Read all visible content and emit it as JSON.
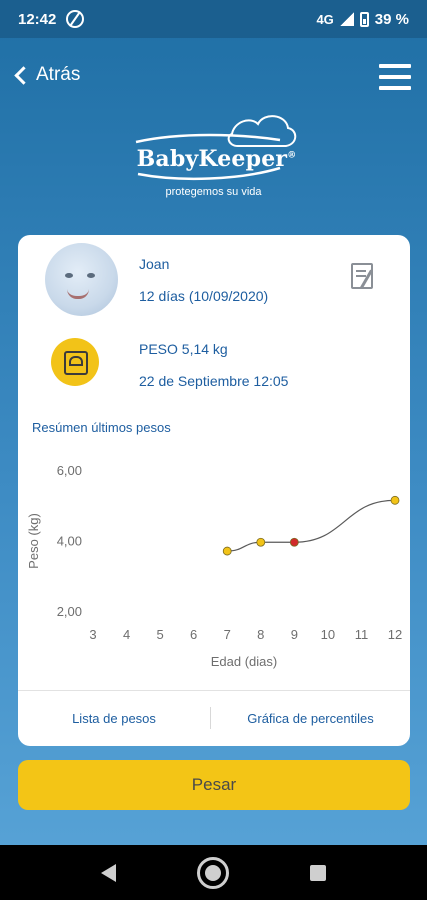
{
  "status_bar": {
    "time": "12:42",
    "network": "4G",
    "battery": "39 %"
  },
  "header": {
    "back_label": "Atrás"
  },
  "logo": {
    "brand": "BabyKeeper",
    "registered": "®",
    "tagline": "protegemos su vida"
  },
  "profile": {
    "name": "Joan",
    "age": "12 días (10/09/2020)"
  },
  "last_weight": {
    "peso": "PESO 5,14 kg",
    "fecha": "22 de Septiembre 12:05"
  },
  "chart_section_title": "Resúmen últimos pesos",
  "chart_data": {
    "type": "line",
    "xlabel": "Edad (dias)",
    "ylabel": "Peso (kg)",
    "x_ticks": [
      3,
      4,
      5,
      6,
      7,
      8,
      9,
      10,
      11,
      12
    ],
    "y_ticks": [
      "2,00",
      "4,00",
      "6,00"
    ],
    "xlim": [
      3,
      12
    ],
    "ylim": [
      2,
      6
    ],
    "series": [
      {
        "x": [
          7,
          8,
          9,
          12
        ],
        "y": [
          3.7,
          3.95,
          3.95,
          5.14
        ],
        "point_colors": [
          "#f2c318",
          "#f2c318",
          "#d12a2a",
          "#f2c318"
        ]
      }
    ],
    "line_color": "#5a5a5a",
    "grid": false
  },
  "links": {
    "lista": "Lista de pesos",
    "percentiles": "Gráfica de percentiles"
  },
  "pesar_label": "Pesar",
  "colors": {
    "accent_yellow": "#f3c516",
    "text_blue": "#1e5ea0",
    "background_blue": "#3e8cc4"
  }
}
